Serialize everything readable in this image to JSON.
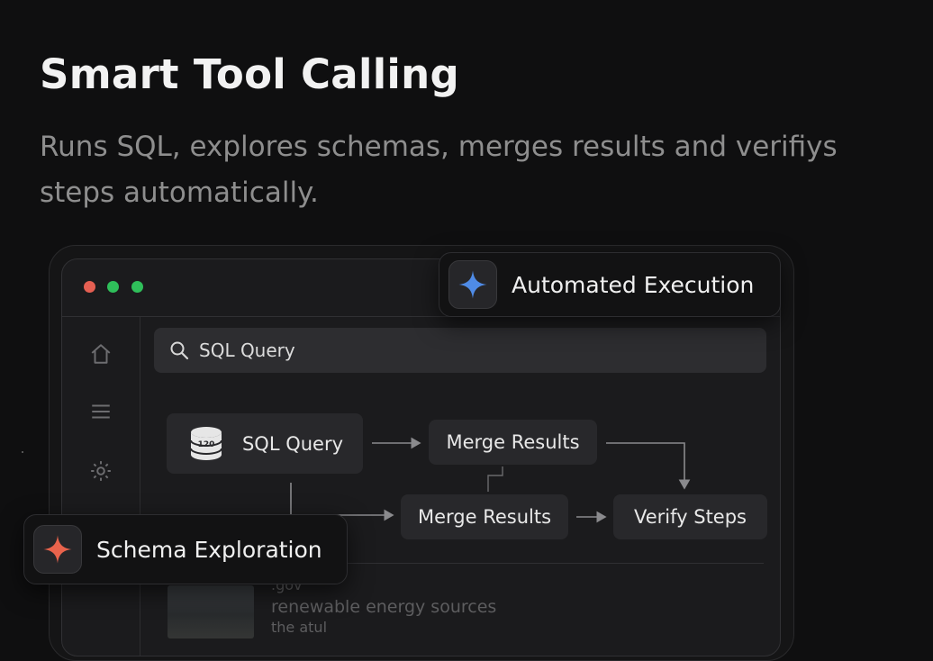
{
  "hero": {
    "title": "Smart Tool Calling",
    "subtitle": "Runs SQL, explores schemas, merges results and verifiys steps automatically."
  },
  "window": {
    "search": {
      "value": "SQL Query",
      "icon": "search-icon"
    },
    "sidebar": {
      "icons": [
        "home-icon",
        "menu-icon",
        "gear-icon"
      ]
    },
    "flow": {
      "sql_node": {
        "label": "SQL Query",
        "icon": "database-icon",
        "icon_text": "120"
      },
      "merge_top": {
        "label": "Merge Results"
      },
      "merge_bottom": {
        "label": "Merge Results"
      },
      "verify": {
        "label": "Verify Steps"
      }
    },
    "result": {
      "line1": ".gov",
      "line2": "renewable energy sources",
      "line3": "the atul"
    }
  },
  "badges": {
    "top": {
      "label": "Automated Execution",
      "icon": "sparkle-icon",
      "color": "#4f8be6"
    },
    "bottom": {
      "label": "Schema Exploration",
      "icon": "sparkle-icon",
      "color": "#e8634c"
    }
  }
}
